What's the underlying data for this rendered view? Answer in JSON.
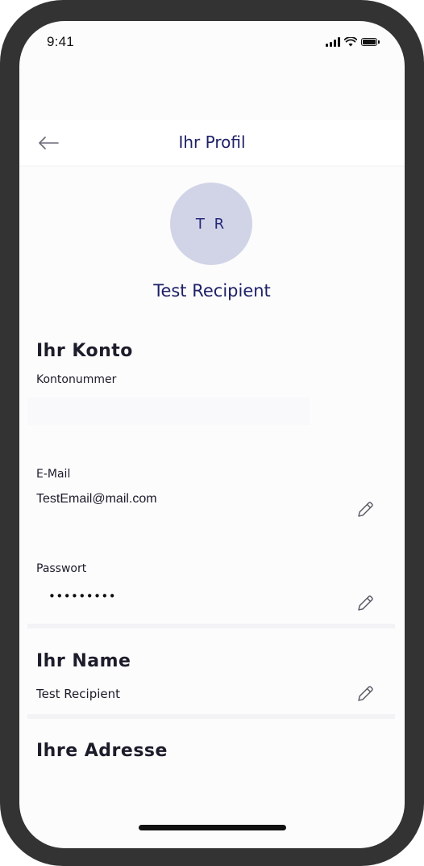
{
  "status_bar": {
    "time": "9:41"
  },
  "header": {
    "title": "Ihr Profil",
    "back_icon": "arrow-left-icon"
  },
  "profile": {
    "initials": "T R",
    "name": "Test Recipient"
  },
  "account_section": {
    "heading": "Ihr Konto",
    "account_number_label": "Kontonummer",
    "account_number_value": "",
    "email_label": "E-Mail",
    "email_value": "TestEmail@mail.com",
    "password_label": "Passwort",
    "password_value": "•••••••••"
  },
  "name_section": {
    "heading": "Ihr Name",
    "value": "Test Recipient"
  },
  "address_section": {
    "heading": "Ihre Adresse"
  },
  "icons": {
    "edit": "pencil-icon"
  },
  "colors": {
    "title_text": "#1f2166",
    "avatar_bg": "#d1d4e6",
    "avatar_text": "#26287a",
    "phone_frame": "#333333",
    "screen_bg": "#fcfcfd"
  }
}
